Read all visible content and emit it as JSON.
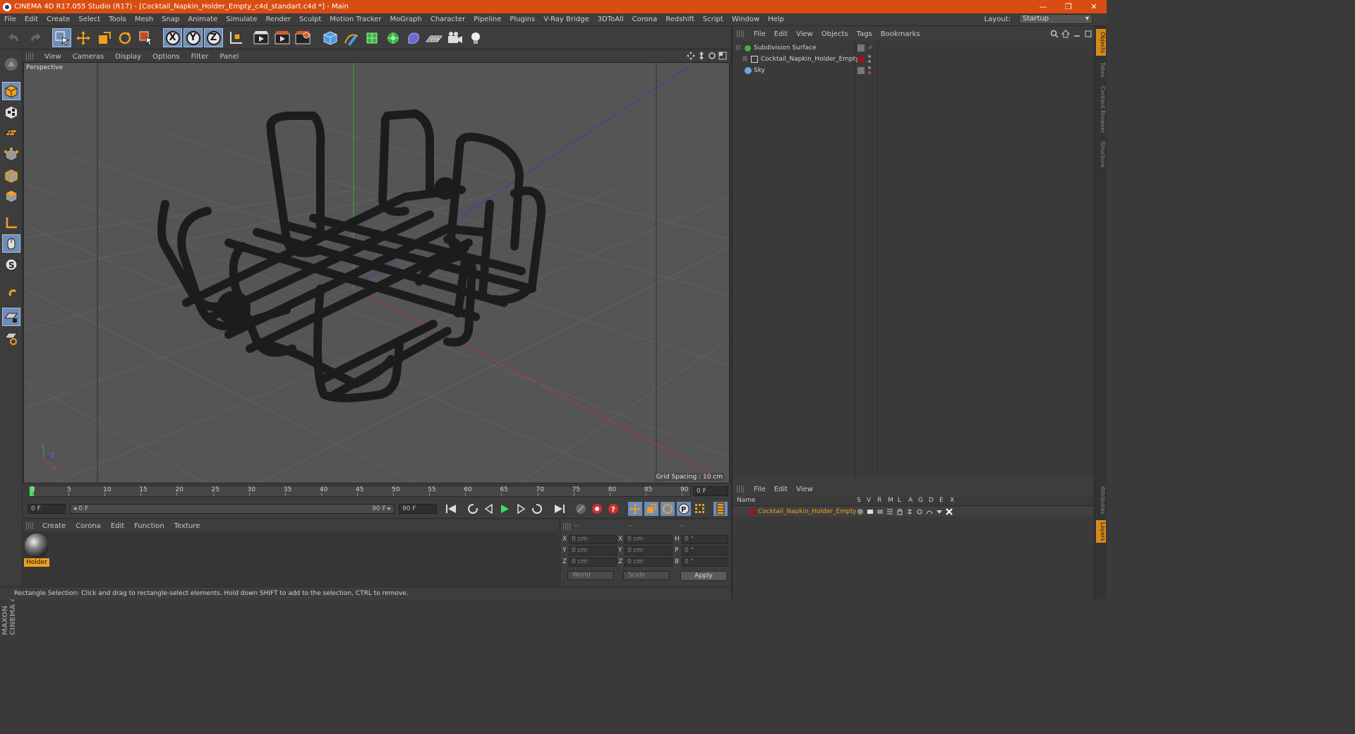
{
  "titlebar": {
    "title": "CINEMA 4D R17.055 Studio (R17) - [Cocktail_Napkin_Holder_Empty_c4d_standart.c4d *] - Main",
    "minimize": "—",
    "maximize": "❐",
    "close": "✕"
  },
  "menu": {
    "items": [
      "File",
      "Edit",
      "Create",
      "Select",
      "Tools",
      "Mesh",
      "Snap",
      "Animate",
      "Simulate",
      "Render",
      "Sculpt",
      "Motion Tracker",
      "MoGraph",
      "Character",
      "Pipeline",
      "Plugins",
      "V-Ray Bridge",
      "3DToAll",
      "Corona",
      "Redshift",
      "Script",
      "Window",
      "Help"
    ],
    "layout_label": "Layout:",
    "layout_value": "Startup"
  },
  "viewport": {
    "menu": [
      "View",
      "Cameras",
      "Display",
      "Options",
      "Filter",
      "Panel"
    ],
    "label": "Perspective",
    "grid_spacing": "Grid Spacing : 10 cm",
    "axis_y": "Y",
    "axis_z": "Z",
    "axis_x": "X"
  },
  "timeline": {
    "ticks": [
      "0",
      "5",
      "10",
      "15",
      "20",
      "25",
      "30",
      "35",
      "40",
      "45",
      "50",
      "55",
      "60",
      "65",
      "70",
      "75",
      "80",
      "85",
      "90"
    ],
    "current_frame": "0 F",
    "start_field": "0 F",
    "range_start": "◂ 0 F",
    "range_end": "90 F ▸",
    "end_field": "90 F"
  },
  "materials": {
    "menu": [
      "Create",
      "Corona",
      "Edit",
      "Function",
      "Texture"
    ],
    "items": [
      {
        "name": "Holder"
      }
    ]
  },
  "coords": {
    "headers": [
      "--",
      "--",
      "--"
    ],
    "rows": [
      {
        "a": "X",
        "av": "0 cm",
        "b": "X",
        "bv": "0 cm",
        "c": "H",
        "cv": "0 °"
      },
      {
        "a": "Y",
        "av": "0 cm",
        "b": "Y",
        "bv": "0 cm",
        "c": "P",
        "cv": "0 °"
      },
      {
        "a": "Z",
        "av": "0 cm",
        "b": "Z",
        "bv": "0 cm",
        "c": "B",
        "cv": "0 °"
      }
    ],
    "mode_world": "World",
    "mode_scale": "Scale",
    "apply": "Apply"
  },
  "status": "Rectangle Selection: Click and drag to rectangle-select elements. Hold down SHIFT to add to the selection, CTRL to remove.",
  "maxon": "MAXON CINEMA 4D",
  "objects": {
    "menu": [
      "File",
      "Edit",
      "View",
      "Objects",
      "Tags",
      "Bookmarks"
    ],
    "rows": [
      {
        "name": "Subdivision Surface",
        "color": "#3fb04a"
      },
      {
        "name": "Cocktail_Napkin_Holder_Empty",
        "color": "#ffffff"
      },
      {
        "name": "Sky",
        "color": "#6aa6e0"
      }
    ]
  },
  "layers": {
    "menu": [
      "File",
      "Edit",
      "View"
    ],
    "header_name": "Name",
    "header_cols": [
      "S",
      "V",
      "R",
      "M",
      "L",
      "A",
      "G",
      "D",
      "E",
      "X"
    ],
    "row_name": "Cocktail_Napkin_Holder_Empty",
    "row_color": "#8a1a2a"
  },
  "sidetabs": [
    "Objects",
    "Takes",
    "Content Browser",
    "Structure",
    "Attributes",
    "Layers"
  ],
  "colors": {
    "title_bar": "#d94d12",
    "accent": "#6f8db8",
    "highlight": "#f0a020"
  }
}
